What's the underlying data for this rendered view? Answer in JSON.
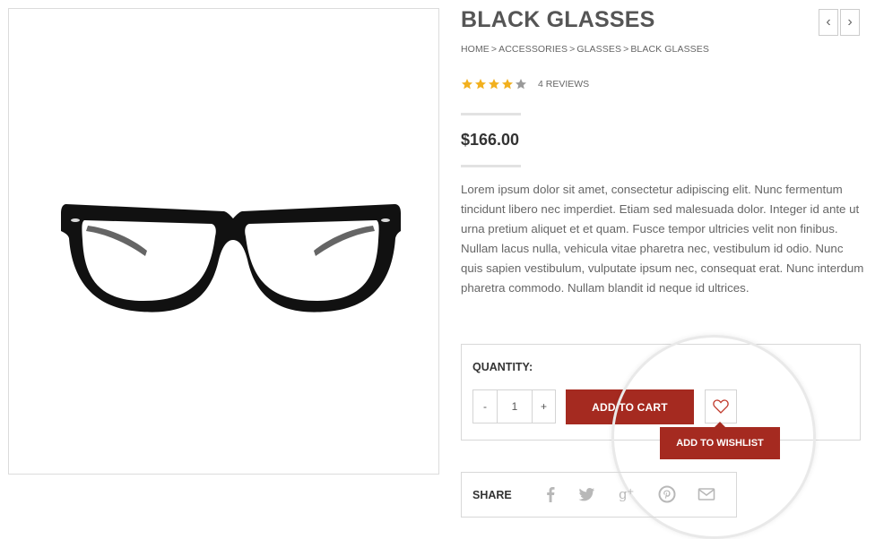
{
  "product": {
    "title": "BLACK GLASSES",
    "price": "$166.00",
    "description": "Lorem ipsum dolor sit amet, consectetur adipiscing elit. Nunc fermentum tincidunt libero nec imperdiet. Etiam sed malesuada dolor. Integer id ante ut urna pretium aliquet et et quam. Fusce tempor ultricies velit non finibus. Nullam lacus nulla, vehicula vitae pharetra nec, vestibulum id odio. Nunc quis sapien vestibulum, vulputate ipsum nec, consequat erat. Nunc interdum pharetra commodo. Nullam blandit id neque id ultrices.",
    "image_icon": "black-glasses-image"
  },
  "navigation": {
    "prev_icon": "chevron-left-icon",
    "next_icon": "chevron-right-icon",
    "prev_glyph": "‹",
    "next_glyph": "›"
  },
  "breadcrumb": {
    "separator": ">",
    "items": [
      "HOME",
      "ACCESSORIES",
      "GLASSES",
      "BLACK GLASSES"
    ]
  },
  "rating": {
    "stars": 4,
    "max": 5,
    "reviews_label": "4 REVIEWS"
  },
  "purchase": {
    "quantity_label": "QUANTITY:",
    "minus_label": "-",
    "quantity_value": "1",
    "plus_label": "+",
    "add_to_cart_label": "ADD TO CART",
    "wishlist_icon": "heart-icon",
    "wishlist_tooltip": "ADD TO WISHLIST"
  },
  "share": {
    "label": "SHARE",
    "icons": [
      "facebook-icon",
      "twitter-icon",
      "google-plus-icon",
      "pinterest-icon",
      "email-icon"
    ]
  },
  "colors": {
    "accent": "#a52a20",
    "star_filled": "#f2b01e",
    "star_empty": "#9a9a9a",
    "heart": "#c0392b",
    "social_icon": "#b8b8b8"
  }
}
